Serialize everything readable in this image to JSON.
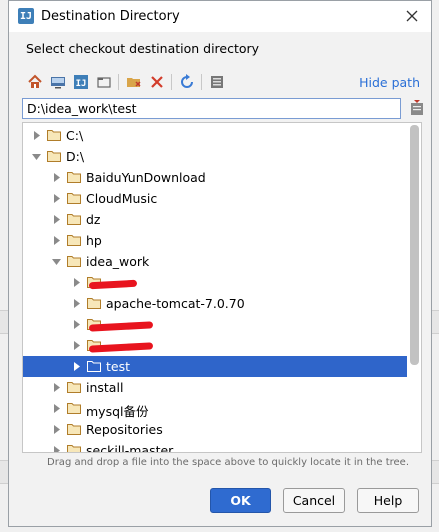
{
  "dialog": {
    "title": "Destination Directory",
    "prompt": "Select checkout destination directory",
    "hide_path_label": "Hide path",
    "path_value": "D:\\idea_work\\test",
    "hint": "Drag and drop a file into the space above to quickly locate it in the tree.",
    "buttons": {
      "ok": "OK",
      "cancel": "Cancel",
      "help": "Help"
    }
  },
  "toolbar": {
    "icons": [
      "home-icon",
      "desktop-icon",
      "project-icon",
      "module-icon",
      "new-folder-icon",
      "delete-icon",
      "refresh-icon",
      "show-hidden-icon"
    ]
  },
  "tree": {
    "rows": [
      {
        "label": "C:\\",
        "expanded": false
      },
      {
        "label": "D:\\",
        "expanded": true
      },
      {
        "label": "BaiduYunDownload",
        "expanded": false
      },
      {
        "label": "CloudMusic",
        "expanded": false
      },
      {
        "label": "dz",
        "expanded": false
      },
      {
        "label": "hp",
        "expanded": false
      },
      {
        "label": "idea_work",
        "expanded": true
      },
      {
        "label": "",
        "expanded": false,
        "redacted": true
      },
      {
        "label": "apache-tomcat-7.0.70",
        "expanded": false
      },
      {
        "label": "",
        "expanded": false,
        "redacted": true
      },
      {
        "label": "",
        "expanded": false,
        "redacted": true
      },
      {
        "label": "test",
        "expanded": false,
        "selected": true
      },
      {
        "label": "install",
        "expanded": false
      },
      {
        "label": "mysql备份",
        "expanded": false
      },
      {
        "label": "Repositories",
        "expanded": false
      },
      {
        "label": "seckill-master",
        "expanded": false
      }
    ]
  },
  "colors": {
    "accent": "#2f65ca",
    "folder": "#d9a54a",
    "link": "#2a6fd6",
    "redaction": "#e8141e"
  }
}
